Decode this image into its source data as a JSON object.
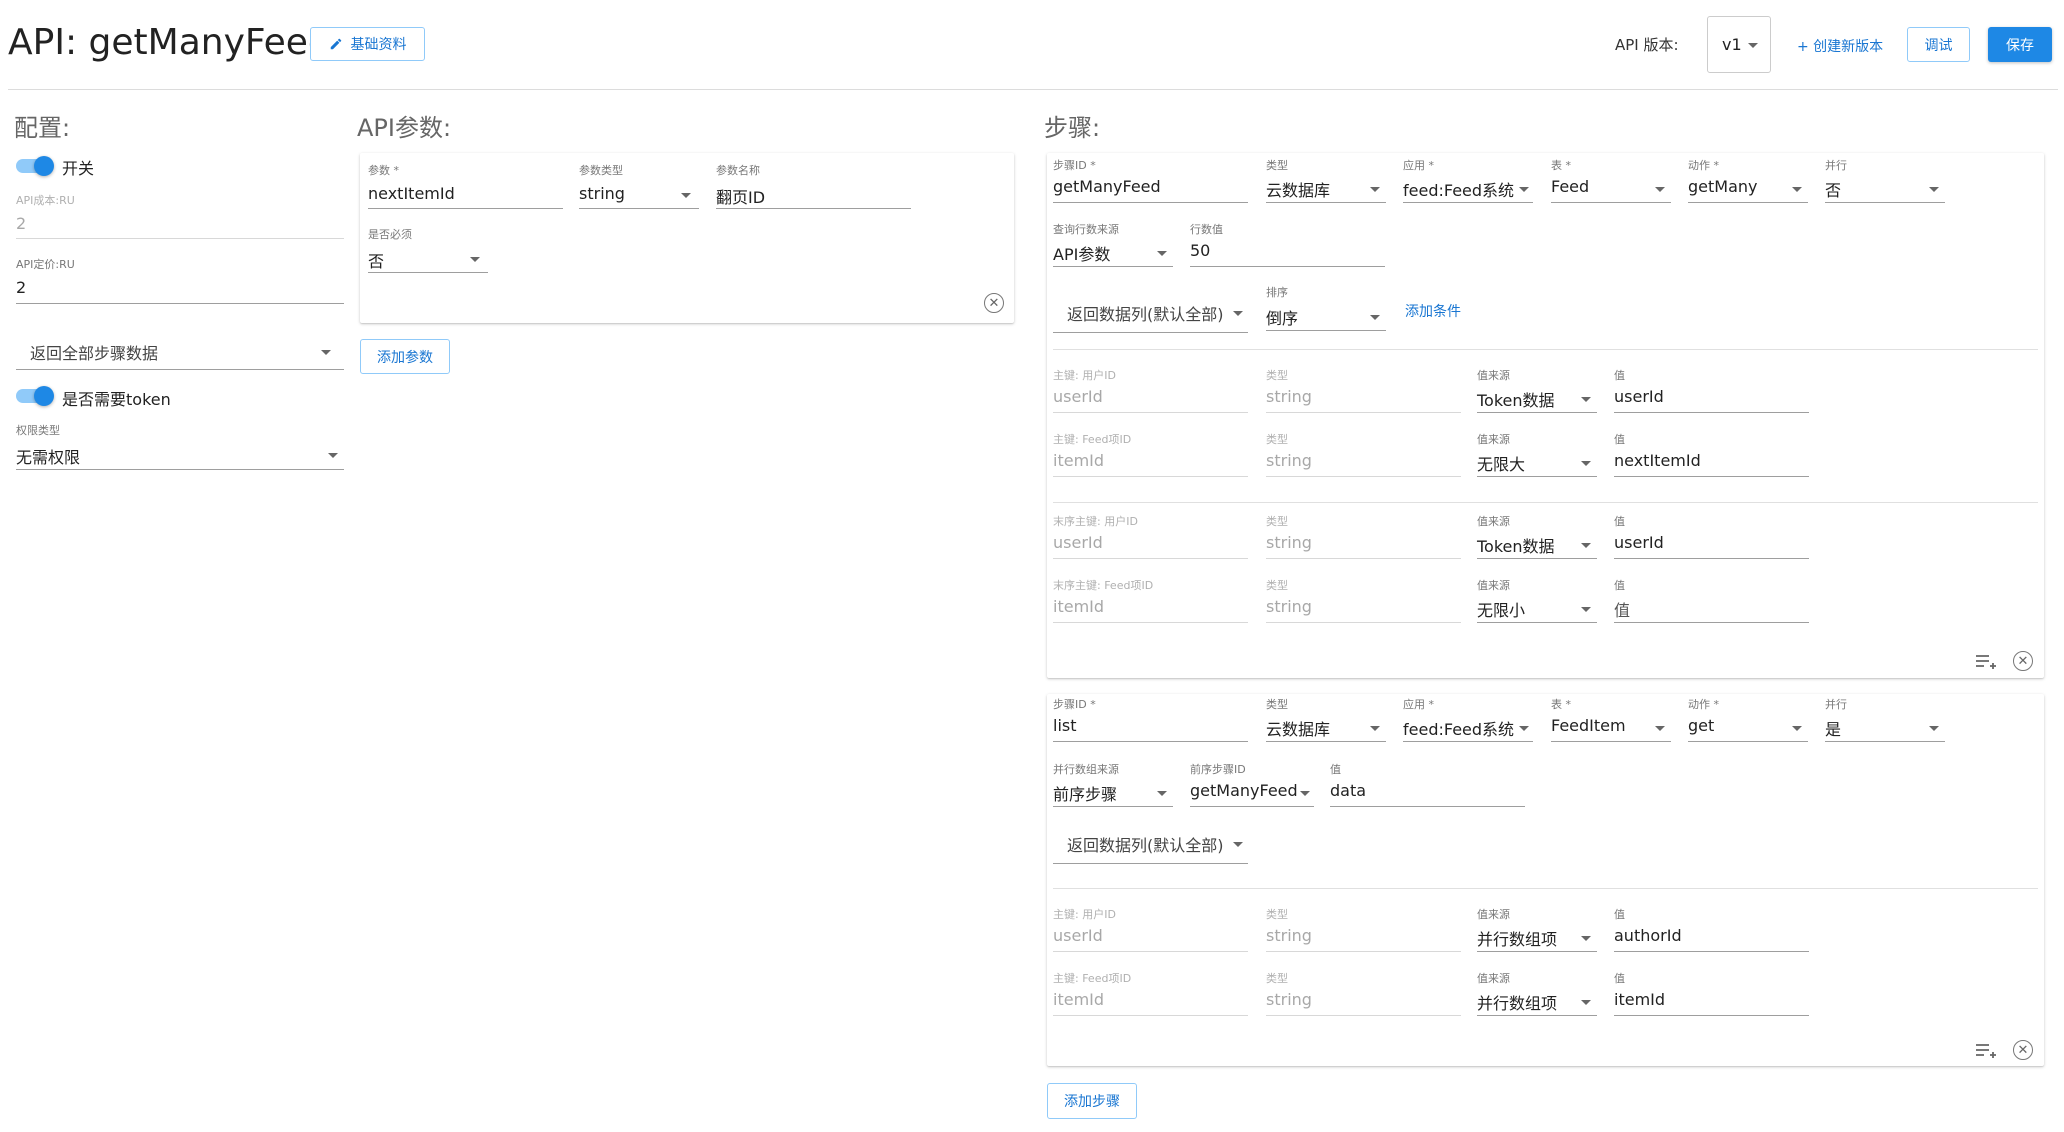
{
  "header": {
    "title": "API: getManyFeed",
    "basic_info_label": "基础资料",
    "version_label": "API 版本:",
    "version_value": "v1",
    "create_version_label": "+ 创建新版本",
    "debug_label": "调试",
    "save_label": "保存"
  },
  "config": {
    "title": "配置:",
    "switch_label": "开关",
    "switch_on": true,
    "cost_label": "API成本:RU",
    "cost_value": "2",
    "price_label": "API定价:RU",
    "price_value": "2",
    "return_select": "返回全部步骤数据",
    "token_label": "是否需要token",
    "token_on": true,
    "perm_label": "权限类型",
    "perm_value": "无需权限"
  },
  "params": {
    "title": "API参数:",
    "param_label": "参数 *",
    "param_value": "nextItemId",
    "type_label": "参数类型",
    "type_value": "string",
    "name_label": "参数名称",
    "name_value": "翻页ID",
    "required_label": "是否必须",
    "required_value": "否",
    "add_button": "添加参数"
  },
  "steps": {
    "title": "步骤:",
    "add_button": "添加步骤",
    "step1": {
      "id_label": "步骤ID *",
      "id_value": "getManyFeed",
      "type_label": "类型",
      "type_value": "云数据库",
      "app_label": "应用 *",
      "app_value": "feed:Feed系统",
      "table_label": "表 *",
      "table_value": "Feed",
      "action_label": "动作 *",
      "action_value": "getMany",
      "parallel_label": "并行",
      "parallel_value": "否",
      "qsrc_label": "查询行数来源",
      "qsrc_value": "API参数",
      "rows_label": "行数值",
      "rows_value": "50",
      "return_cols": "返回数据列(默认全部)",
      "sort_label": "排序",
      "sort_value": "倒序",
      "add_condition": "添加条件",
      "keys": [
        {
          "label": "主键: 用户ID",
          "field": "userId",
          "type_label": "类型",
          "type": "string",
          "src_label": "值来源",
          "src": "Token数据",
          "val_label": "值",
          "val": "userId"
        },
        {
          "label": "主键: Feed项ID",
          "field": "itemId",
          "type_label": "类型",
          "type": "string",
          "src_label": "值来源",
          "src": "无限大",
          "val_label": "值",
          "val": "nextItemId"
        }
      ],
      "end_keys": [
        {
          "label": "末序主键: 用户ID",
          "field": "userId",
          "type_label": "类型",
          "type": "string",
          "src_label": "值来源",
          "src": "Token数据",
          "val_label": "值",
          "val": "userId"
        },
        {
          "label": "末序主键: Feed项ID",
          "field": "itemId",
          "type_label": "类型",
          "type": "string",
          "src_label": "值来源",
          "src": "无限小",
          "val_label": "值",
          "val": "值"
        }
      ]
    },
    "step2": {
      "id_label": "步骤ID *",
      "id_value": "list",
      "type_label": "类型",
      "type_value": "云数据库",
      "app_label": "应用 *",
      "app_value": "feed:Feed系统",
      "table_label": "表 *",
      "table_value": "FeedItem",
      "action_label": "动作 *",
      "action_value": "get",
      "parallel_label": "并行",
      "parallel_value": "是",
      "psrc_label": "并行数组来源",
      "psrc_value": "前序步骤",
      "prev_label": "前序步骤ID",
      "prev_value": "getManyFeed",
      "val_label": "值",
      "val_value": "data",
      "return_cols": "返回数据列(默认全部)",
      "keys": [
        {
          "label": "主键: 用户ID",
          "field": "userId",
          "type_label": "类型",
          "type": "string",
          "src_label": "值来源",
          "src": "并行数组项",
          "val_label": "值",
          "val": "authorId"
        },
        {
          "label": "主键: Feed项ID",
          "field": "itemId",
          "type_label": "类型",
          "type": "string",
          "src_label": "值来源",
          "src": "并行数组项",
          "val_label": "值",
          "val": "itemId"
        }
      ]
    }
  },
  "colors": {
    "primary": "#1e88e5",
    "switch_track": "#90caf9",
    "link": "#1976d2"
  }
}
